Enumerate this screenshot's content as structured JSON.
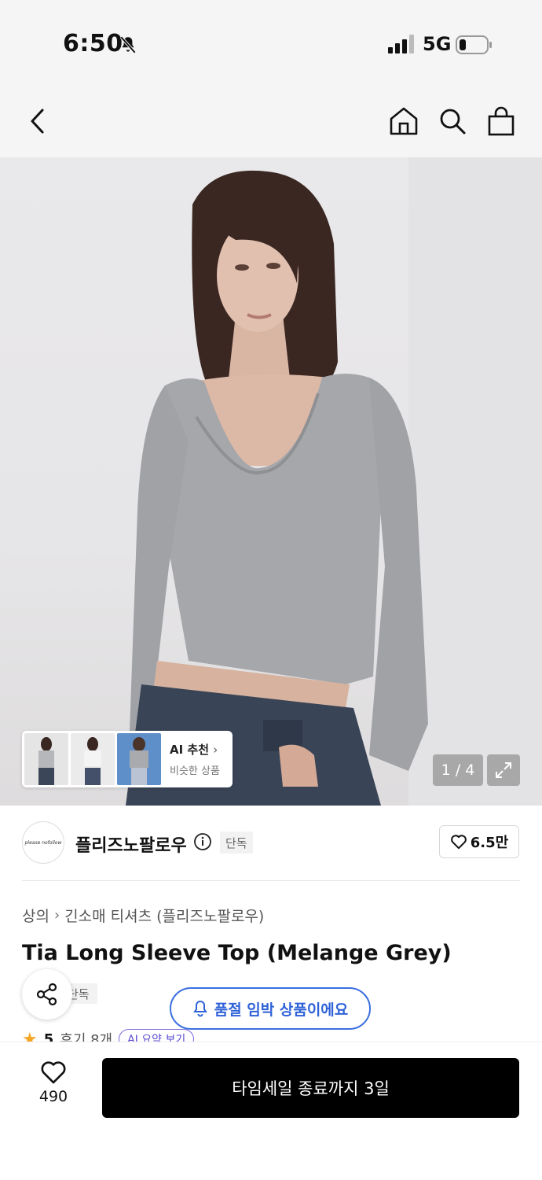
{
  "status_bar": {
    "time": "6:50",
    "network": "5G"
  },
  "gallery": {
    "pager": "1 / 4",
    "recommendation": {
      "title": "AI 추천",
      "subtitle": "비슷한 상품"
    }
  },
  "brand": {
    "name": "플리즈노팔로우",
    "logo_text": "please nofollow",
    "badge": "단독",
    "likes": "6.5만"
  },
  "product": {
    "breadcrumb": [
      "상의",
      "긴소매 티셔츠 (플리즈노팔로우)"
    ],
    "title": "Tia Long Sleeve Top (Melange Grey)",
    "badge": "단독",
    "rating": "5",
    "reviews": "후기 8개",
    "ai_summary": "AI 요약 보기"
  },
  "notice": {
    "soldout_soon": "품절 임박 상품이에요"
  },
  "bottom_bar": {
    "wish_count": "490",
    "buy_label": "타임세일 종료까지 3일"
  },
  "colors": {
    "accent_blue": "#2f62d8",
    "star": "#f5a623",
    "ai_purple": "#5a4bd0"
  }
}
